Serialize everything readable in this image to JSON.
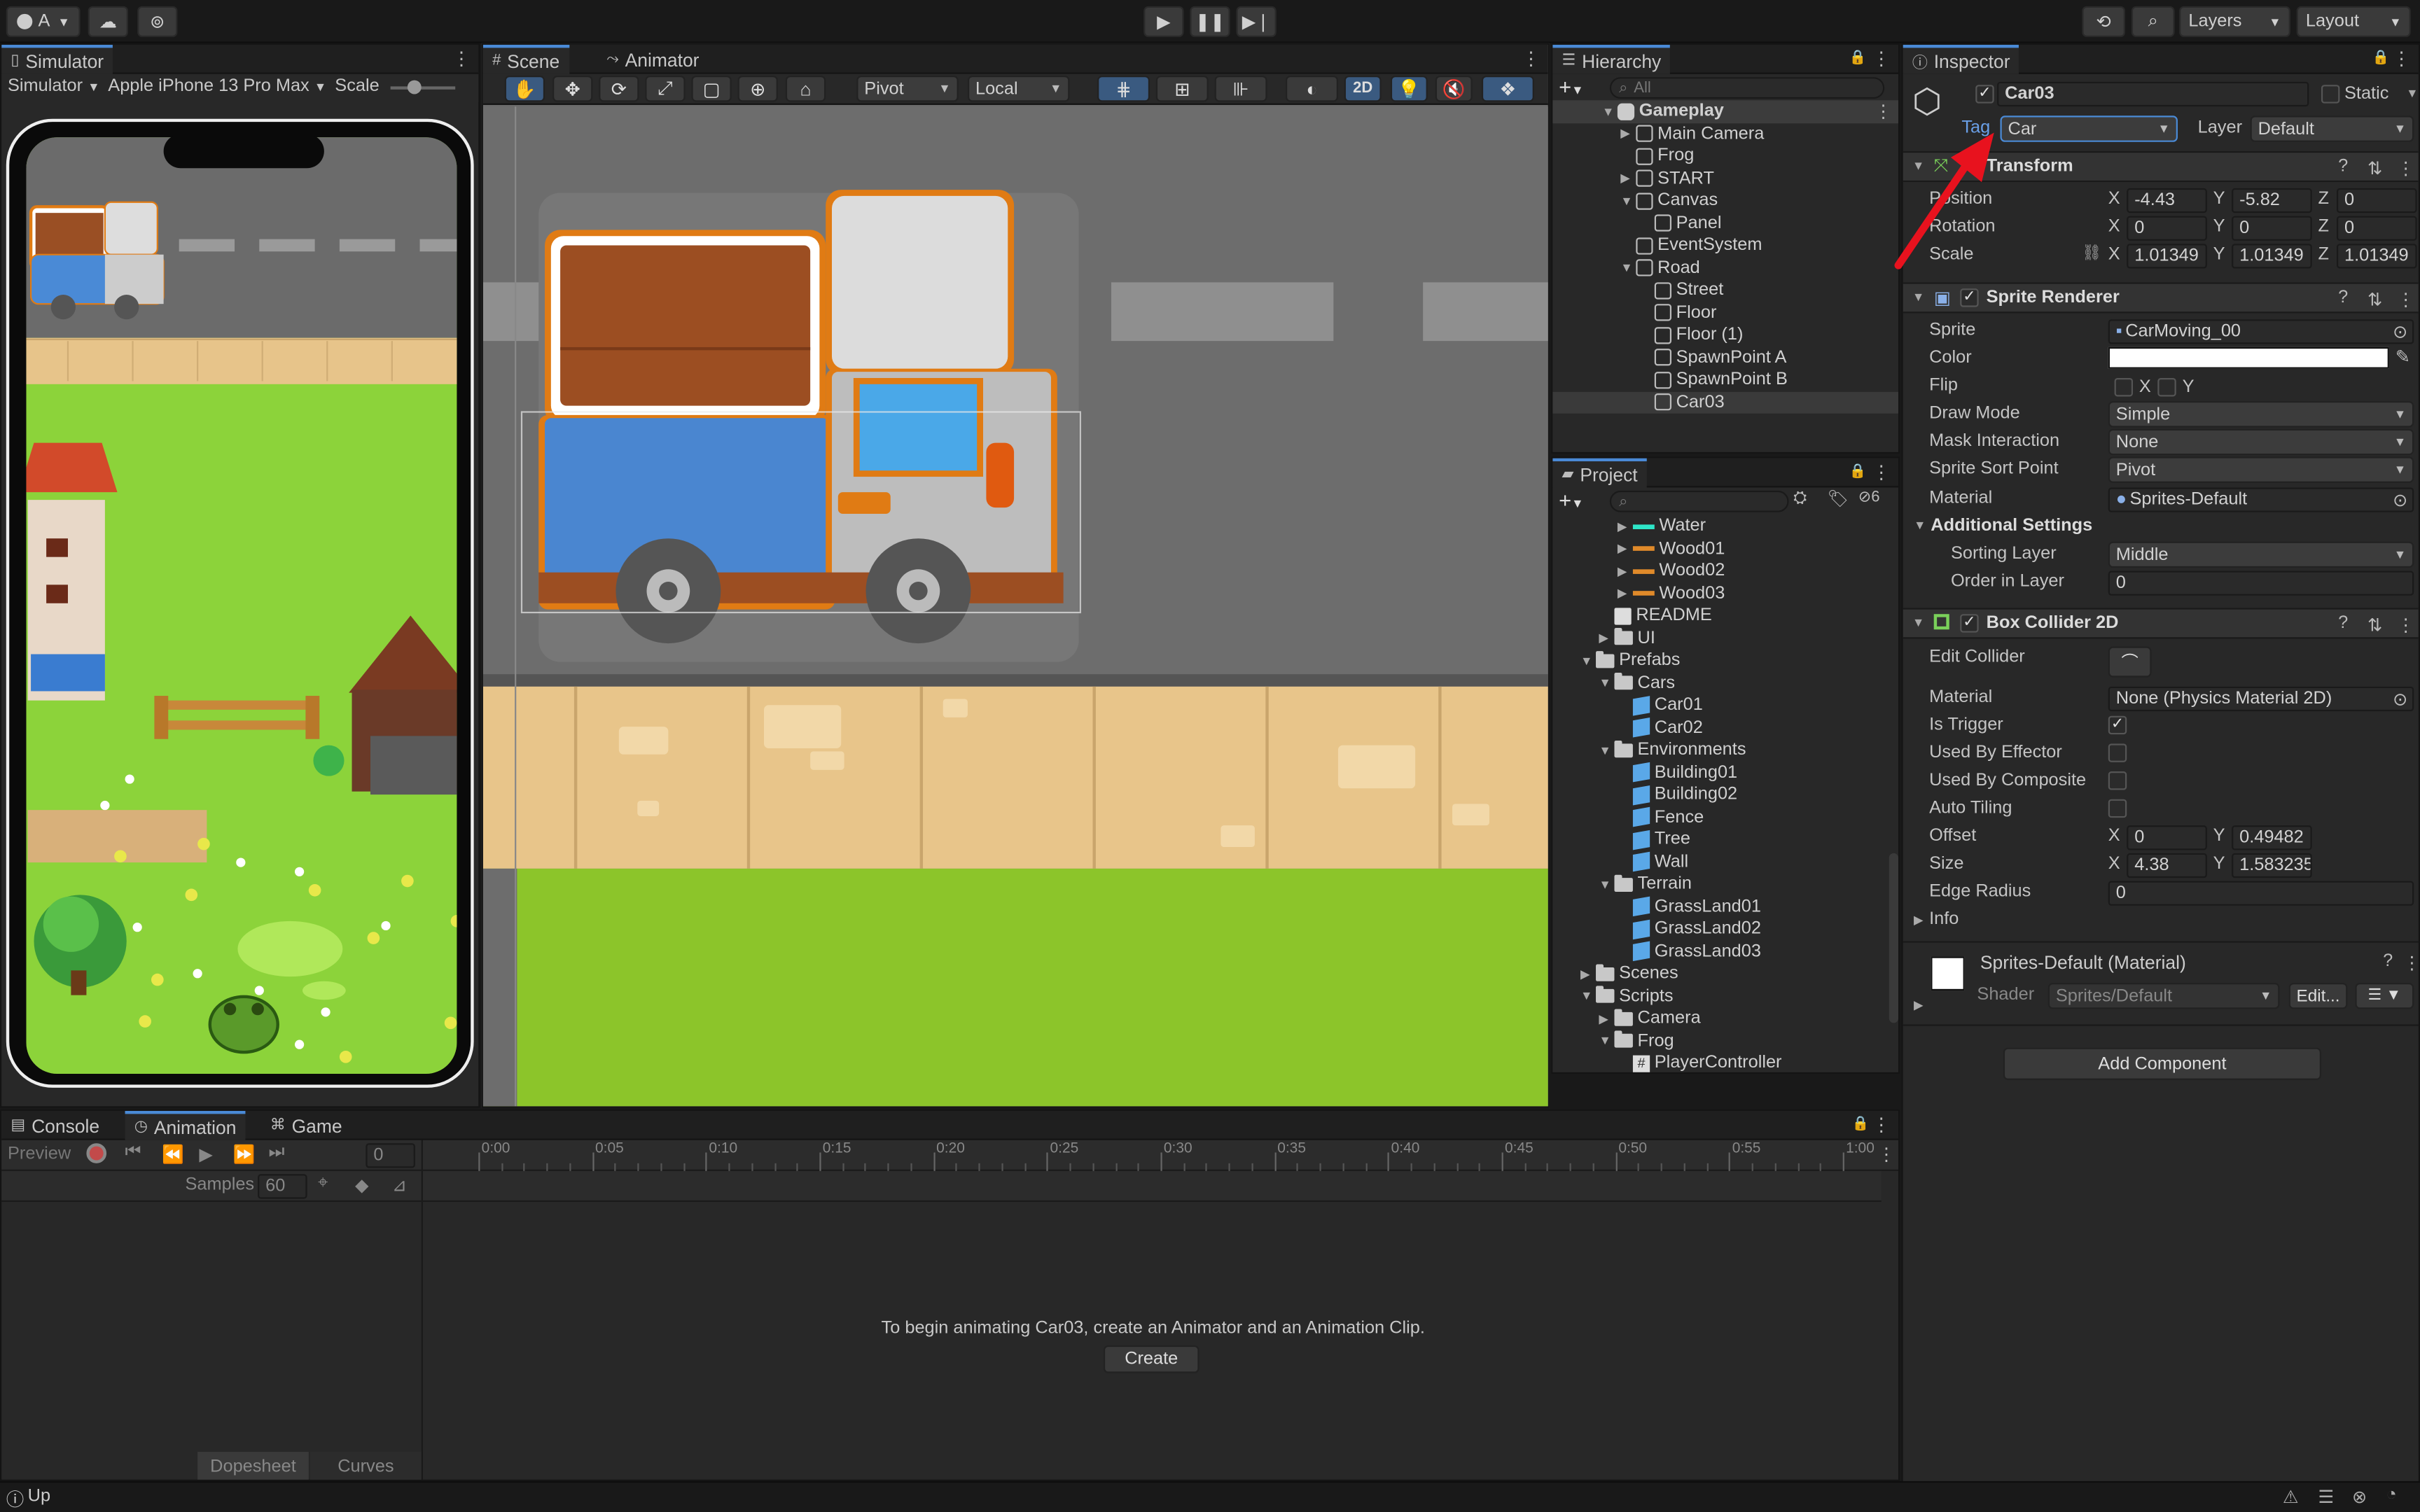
{
  "toolbar": {
    "account_label": "A",
    "layers_label": "Layers",
    "layout_label": "Layout"
  },
  "simulator": {
    "tab": "Simulator",
    "mode": "Simulator",
    "device": "Apple iPhone 13 Pro Max",
    "scale_label": "Scale"
  },
  "scene": {
    "tab_scene": "Scene",
    "tab_animator": "Animator",
    "pivot": "Pivot",
    "local": "Local",
    "mode_2d": "2D"
  },
  "hierarchy": {
    "tab": "Hierarchy",
    "search_placeholder": "All",
    "items": [
      {
        "label": "Gameplay",
        "level": 0,
        "fold": "open",
        "kind": "scene"
      },
      {
        "label": "Main Camera",
        "level": 1,
        "fold": "closed",
        "kind": "cube"
      },
      {
        "label": "Frog",
        "level": 1,
        "fold": "none",
        "kind": "cube"
      },
      {
        "label": "START",
        "level": 1,
        "fold": "closed",
        "kind": "cube"
      },
      {
        "label": "Canvas",
        "level": 1,
        "fold": "open",
        "kind": "cube"
      },
      {
        "label": "Panel",
        "level": 2,
        "fold": "none",
        "kind": "cube"
      },
      {
        "label": "EventSystem",
        "level": 1,
        "fold": "none",
        "kind": "cube"
      },
      {
        "label": "Road",
        "level": 1,
        "fold": "open",
        "kind": "cube"
      },
      {
        "label": "Street",
        "level": 2,
        "fold": "none",
        "kind": "cube"
      },
      {
        "label": "Floor",
        "level": 2,
        "fold": "none",
        "kind": "cube"
      },
      {
        "label": "Floor (1)",
        "level": 2,
        "fold": "none",
        "kind": "cube"
      },
      {
        "label": "SpawnPoint A",
        "level": 2,
        "fold": "none",
        "kind": "cube"
      },
      {
        "label": "SpawnPoint B",
        "level": 2,
        "fold": "none",
        "kind": "cube"
      },
      {
        "label": "Car03",
        "level": 2,
        "fold": "none",
        "kind": "cube",
        "selected": true
      }
    ]
  },
  "project": {
    "tab": "Project",
    "hidden_count": "6",
    "items": [
      {
        "label": "Water",
        "level": 2,
        "fold": "closed",
        "kind": "sprite",
        "color": "#2ee6c8"
      },
      {
        "label": "Wood01",
        "level": 2,
        "fold": "closed",
        "kind": "sprite",
        "color": "#e08a2a"
      },
      {
        "label": "Wood02",
        "level": 2,
        "fold": "closed",
        "kind": "sprite",
        "color": "#e08a2a"
      },
      {
        "label": "Wood03",
        "level": 2,
        "fold": "closed",
        "kind": "sprite",
        "color": "#e08a2a"
      },
      {
        "label": "README",
        "level": 1,
        "fold": "none",
        "kind": "doc"
      },
      {
        "label": "UI",
        "level": 1,
        "fold": "closed",
        "kind": "folder"
      },
      {
        "label": "Prefabs",
        "level": 0,
        "fold": "open",
        "kind": "folder"
      },
      {
        "label": "Cars",
        "level": 1,
        "fold": "open",
        "kind": "folder"
      },
      {
        "label": "Car01",
        "level": 2,
        "fold": "none",
        "kind": "prefab"
      },
      {
        "label": "Car02",
        "level": 2,
        "fold": "none",
        "kind": "prefab"
      },
      {
        "label": "Environments",
        "level": 1,
        "fold": "open",
        "kind": "folder"
      },
      {
        "label": "Building01",
        "level": 2,
        "fold": "none",
        "kind": "prefab"
      },
      {
        "label": "Building02",
        "level": 2,
        "fold": "none",
        "kind": "prefab"
      },
      {
        "label": "Fence",
        "level": 2,
        "fold": "none",
        "kind": "prefab"
      },
      {
        "label": "Tree",
        "level": 2,
        "fold": "none",
        "kind": "prefab"
      },
      {
        "label": "Wall",
        "level": 2,
        "fold": "none",
        "kind": "prefab"
      },
      {
        "label": "Terrain",
        "level": 1,
        "fold": "open",
        "kind": "folder"
      },
      {
        "label": "GrassLand01",
        "level": 2,
        "fold": "none",
        "kind": "prefab"
      },
      {
        "label": "GrassLand02",
        "level": 2,
        "fold": "none",
        "kind": "prefab"
      },
      {
        "label": "GrassLand03",
        "level": 2,
        "fold": "none",
        "kind": "prefab"
      },
      {
        "label": "Scenes",
        "level": 0,
        "fold": "closed",
        "kind": "folder"
      },
      {
        "label": "Scripts",
        "level": 0,
        "fold": "open",
        "kind": "folder"
      },
      {
        "label": "Camera",
        "level": 1,
        "fold": "closed",
        "kind": "folder"
      },
      {
        "label": "Frog",
        "level": 1,
        "fold": "open",
        "kind": "folder"
      },
      {
        "label": "PlayerController",
        "level": 2,
        "fold": "none",
        "kind": "script"
      }
    ]
  },
  "inspector": {
    "tab": "Inspector",
    "object_name": "Car03",
    "static_label": "Static",
    "tag_label": "Tag",
    "tag_value": "Car",
    "layer_label": "Layer",
    "layer_value": "Default",
    "transform": {
      "title": "Transform",
      "position_label": "Position",
      "rotation_label": "Rotation",
      "scale_label": "Scale",
      "position": {
        "x": "-4.43",
        "y": "-5.82",
        "z": "0"
      },
      "rotation": {
        "x": "0",
        "y": "0",
        "z": "0"
      },
      "scale": {
        "x": "1.01349",
        "y": "1.01349",
        "z": "1.01349"
      }
    },
    "sprite_renderer": {
      "title": "Sprite Renderer",
      "sprite_label": "Sprite",
      "sprite_value": "CarMoving_00",
      "color_label": "Color",
      "flip_label": "Flip",
      "draw_mode_label": "Draw Mode",
      "draw_mode_value": "Simple",
      "mask_label": "Mask Interaction",
      "mask_value": "None",
      "sort_point_label": "Sprite Sort Point",
      "sort_point_value": "Pivot",
      "material_label": "Material",
      "material_value": "Sprites-Default",
      "additional_label": "Additional Settings",
      "sorting_layer_label": "Sorting Layer",
      "sorting_layer_value": "Middle",
      "order_label": "Order in Layer",
      "order_value": "0"
    },
    "box_collider": {
      "title": "Box Collider 2D",
      "edit_label": "Edit Collider",
      "material_label": "Material",
      "material_value": "None (Physics Material 2D)",
      "trigger_label": "Is Trigger",
      "effector_label": "Used By Effector",
      "composite_label": "Used By Composite",
      "tiling_label": "Auto Tiling",
      "offset_label": "Offset",
      "offset": {
        "x": "0",
        "y": "0.49482"
      },
      "size_label": "Size",
      "size": {
        "x": "4.38",
        "y": "1.583235"
      },
      "edge_label": "Edge Radius",
      "edge_value": "0",
      "info_label": "Info"
    },
    "material_block": {
      "name": "Sprites-Default (Material)",
      "shader_label": "Shader",
      "shader_value": "Sprites/Default",
      "edit_label": "Edit..."
    },
    "add_component": "Add Component",
    "x": "X",
    "y": "Y",
    "z": "Z"
  },
  "bottom": {
    "tab_console": "Console",
    "tab_animation": "Animation",
    "tab_game": "Game",
    "preview_label": "Preview",
    "frame_value": "0",
    "samples_label": "Samples",
    "samples_value": "60",
    "timeline_ticks": [
      "0:00",
      "0:05",
      "0:10",
      "0:15",
      "0:20",
      "0:25",
      "0:30",
      "0:35",
      "0:40",
      "0:45",
      "0:50",
      "0:55",
      "1:00"
    ],
    "message": "To begin animating Car03, create an Animator and an Animation Clip.",
    "create_label": "Create",
    "dopesheet_label": "Dopesheet",
    "curves_label": "Curves"
  },
  "status": {
    "text": "Up"
  },
  "colors": {
    "accent": "#4a8ad6",
    "selection": "#2c5d87",
    "arrow": "#e8121e"
  }
}
